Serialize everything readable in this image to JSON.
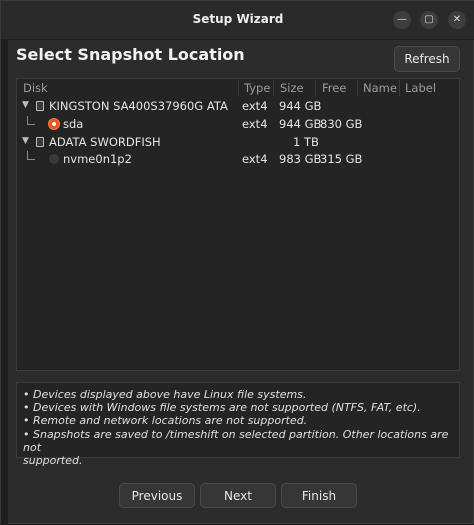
{
  "window": {
    "title": "Setup Wizard"
  },
  "heading": "Select Snapshot Location",
  "refresh_label": "Refresh",
  "columns": [
    "Disk",
    "Type",
    "Size",
    "Free",
    "Name",
    "Label"
  ],
  "rows": [
    {
      "name": "KINGSTON SA400S37960G ATA",
      "type": "ext4",
      "size": "944 GB",
      "free": "",
      "kind": "disk",
      "icon": "drive-icon"
    },
    {
      "name": "sda",
      "type": "ext4",
      "size": "944 GB",
      "free": "830 GB",
      "kind": "partition",
      "selected": true
    },
    {
      "name": "ADATA SWORDFISH",
      "type": "",
      "size": "1 TB",
      "free": "",
      "kind": "disk",
      "icon": "drive-icon"
    },
    {
      "name": "nvme0n1p2",
      "type": "ext4",
      "size": "983 GB",
      "free": "315 GB",
      "kind": "partition",
      "selected": false
    }
  ],
  "notes": [
    "• Devices displayed above have Linux file systems.",
    "• Devices with Windows file systems are not supported (NTFS, FAT, etc).",
    "• Remote and network locations are not supported.",
    "• Snapshots are saved to /timeshift on selected partition. Other locations are not",
    "supported."
  ],
  "buttons": {
    "previous": "Previous",
    "next": "Next",
    "finish": "Finish"
  },
  "colors": {
    "accent": "#e95420",
    "background": "#2c2c2c"
  }
}
